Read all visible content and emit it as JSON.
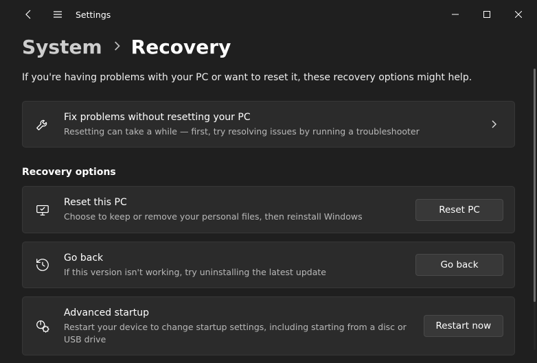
{
  "app": {
    "title": "Settings"
  },
  "breadcrumb": {
    "parent": "System",
    "current": "Recovery"
  },
  "page": {
    "description": "If you're having problems with your PC or want to reset it, these recovery options might help."
  },
  "troubleshoot": {
    "title": "Fix problems without resetting your PC",
    "subtitle": "Resetting can take a while — first, try resolving issues by running a troubleshooter"
  },
  "section": {
    "heading": "Recovery options"
  },
  "reset": {
    "title": "Reset this PC",
    "subtitle": "Choose to keep or remove your personal files, then reinstall Windows",
    "button": "Reset PC"
  },
  "goback": {
    "title": "Go back",
    "subtitle": "If this version isn't working, try uninstalling the latest update",
    "button": "Go back"
  },
  "advanced": {
    "title": "Advanced startup",
    "subtitle": "Restart your device to change startup settings, including starting from a disc or USB drive",
    "button": "Restart now"
  }
}
